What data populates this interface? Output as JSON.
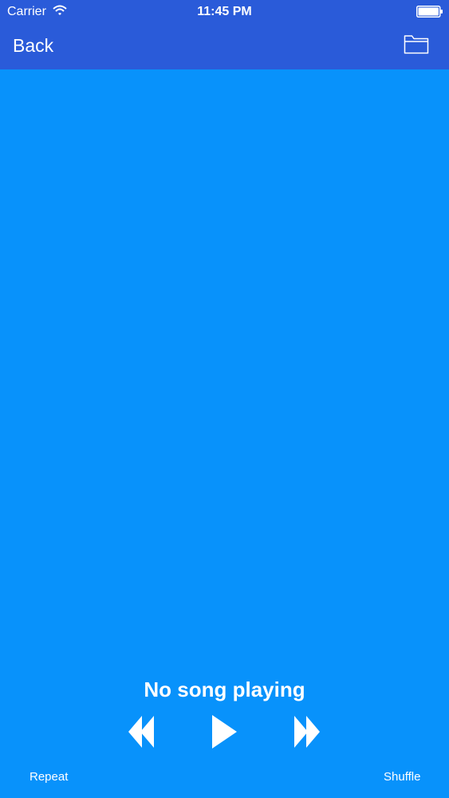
{
  "status_bar": {
    "carrier": "Carrier",
    "time": "11:45 PM",
    "wifi_icon": "wifi-icon",
    "battery_icon": "battery-icon"
  },
  "nav_bar": {
    "back_label": "Back",
    "folder_icon": "folder-icon"
  },
  "player": {
    "now_playing": "No song playing",
    "controls": {
      "previous_icon": "rewind-icon",
      "play_icon": "play-icon",
      "next_icon": "fast-forward-icon"
    },
    "repeat_label": "Repeat",
    "shuffle_label": "Shuffle"
  },
  "colors": {
    "header": "#2a5bd9",
    "background": "#0892fb",
    "text": "#ffffff"
  }
}
